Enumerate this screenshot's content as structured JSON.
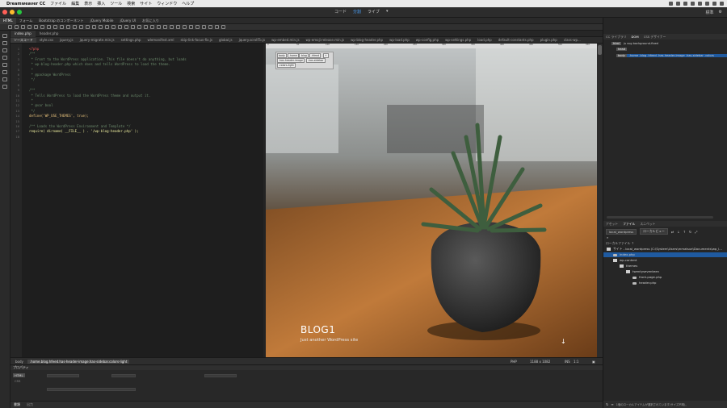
{
  "menubar": {
    "app_name": "Dreamweaver CC",
    "items": [
      "ファイル",
      "編集",
      "表示",
      "挿入",
      "ツール",
      "検索",
      "サイト",
      "ウィンドウ",
      "ヘルプ"
    ]
  },
  "toolbar": {
    "modes": [
      "コード",
      "分割",
      "ライブ"
    ],
    "active_mode": "分割",
    "workspace": "標準"
  },
  "insert_tabs": [
    "HTML",
    "フォーム",
    "Bootstrap のコンポーネント",
    "jQuery Mobile",
    "jQuery UI",
    "お気に入り"
  ],
  "document_tabs": [
    "index.php",
    "header.php"
  ],
  "related_files": [
    "ソースコード",
    "style.css",
    "jquery.js",
    "jquery-migrate.min.js",
    "settings.php",
    "wlemanifest.xml",
    "skip-link-focus-fix.js",
    "global.js",
    "jquery.scrollTo.js",
    "wp-embed.min.js",
    "wp-emoji-release.min.js",
    "wp-blog-header.php",
    "wp-load.php",
    "wp-config.php",
    "wp-settings.php",
    "load.php",
    "default-constants.php",
    "plugin.php",
    "class-wp..."
  ],
  "code": {
    "line_numbers": [
      "1",
      "2",
      "3",
      "4",
      "5",
      "6",
      "7",
      "8",
      "9",
      "10",
      "11",
      "12",
      "13",
      "14",
      "15",
      "16",
      "17",
      "18"
    ],
    "lines": [
      "<?php",
      "/**",
      " * Front to the WordPress application. This file doesn't do anything, but loads",
      " * wp-blog-header.php which does and tells WordPress to load the theme.",
      " *",
      " * @package WordPress",
      " */",
      "",
      "/**",
      " * Tells WordPress to load the WordPress theme and output it.",
      " *",
      " * @var bool",
      " */",
      "define('WP_USE_THEMES', true);",
      "",
      "/** Loads the WordPress Environment and Template */",
      "require( dirname( __FILE__ ) . '/wp-blog-header.php' );",
      ""
    ]
  },
  "live_view": {
    "element_hud": [
      "body",
      ".home",
      ".blog",
      ".hfeed",
      ".has-header-image",
      ".has-sidebar",
      ".colors-light"
    ],
    "blog_title": "BLOG1",
    "blog_description": "Just another WordPress site",
    "scroll_arrow": "↓"
  },
  "status_bar": {
    "crumbs": [
      "body",
      ".home.blog.hfeed.has-header-image.has-sidebar.colors-light"
    ],
    "language": "PHP",
    "dimensions": "1188 x 1082",
    "ins": "INS",
    "position": "1:1"
  },
  "properties": {
    "title": "プロパティ",
    "labels": [
      "HTML",
      "CSS"
    ],
    "footer_left": "書類",
    "footer_right": "出力"
  },
  "right_panel": {
    "top_tabs": [
      "CC ライブラリ",
      "DOM",
      "CSS デザイナー"
    ],
    "dom_rows": [
      {
        "tag": "html",
        "text": "js svg background-fixed"
      },
      {
        "tag": "head",
        "text": ""
      },
      {
        "tag": "body",
        "text": ".home .blog .hfeed .has-header-image .has-sidebar .colors"
      }
    ],
    "files_tabs": [
      "アセット",
      "ファイル",
      "スニペット"
    ],
    "site_select": "local_wordpress",
    "view_select": "ローカルビュー",
    "local_files_label": "ローカルファイル ↑",
    "tree": [
      {
        "label": "サイト - local_wordpress (C:\\System\\Users\\mmatsue\\Documents\\wp_l...",
        "indent": 0,
        "folder": true
      },
      {
        "label": "index.php",
        "indent": 1,
        "folder": false,
        "selected": true
      },
      {
        "label": "wp-content",
        "indent": 1,
        "folder": true
      },
      {
        "label": "themes",
        "indent": 2,
        "folder": true
      },
      {
        "label": "twentyseventeen",
        "indent": 3,
        "folder": true
      },
      {
        "label": "front-page.php",
        "indent": 4,
        "folder": false
      },
      {
        "label": "header.php",
        "indent": 4,
        "folder": false
      }
    ],
    "footer_status": "1個のローカルアイテムが選択されています(サイズ不明)。"
  },
  "colors": {
    "accent": "#4aa3ff",
    "selection": "#1f5aa0"
  }
}
